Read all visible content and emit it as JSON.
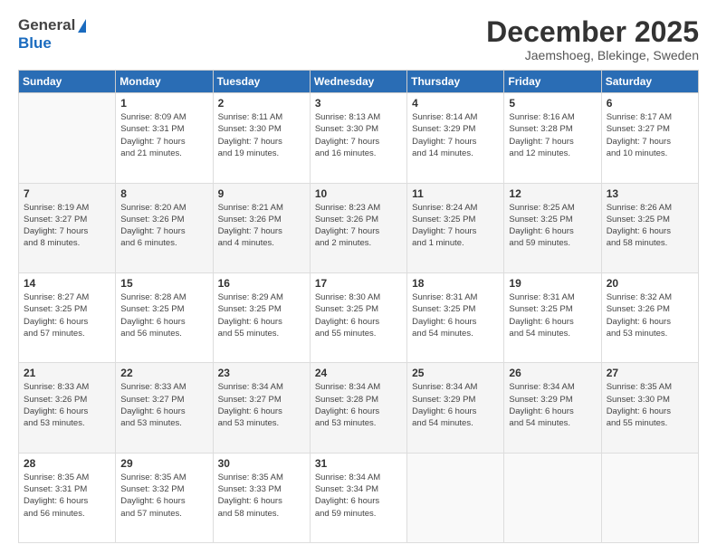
{
  "header": {
    "logo_general": "General",
    "logo_blue": "Blue",
    "title": "December 2025",
    "subtitle": "Jaemshoeg, Blekinge, Sweden"
  },
  "calendar": {
    "days_of_week": [
      "Sunday",
      "Monday",
      "Tuesday",
      "Wednesday",
      "Thursday",
      "Friday",
      "Saturday"
    ],
    "weeks": [
      [
        {
          "day": "",
          "info": ""
        },
        {
          "day": "1",
          "info": "Sunrise: 8:09 AM\nSunset: 3:31 PM\nDaylight: 7 hours\nand 21 minutes."
        },
        {
          "day": "2",
          "info": "Sunrise: 8:11 AM\nSunset: 3:30 PM\nDaylight: 7 hours\nand 19 minutes."
        },
        {
          "day": "3",
          "info": "Sunrise: 8:13 AM\nSunset: 3:30 PM\nDaylight: 7 hours\nand 16 minutes."
        },
        {
          "day": "4",
          "info": "Sunrise: 8:14 AM\nSunset: 3:29 PM\nDaylight: 7 hours\nand 14 minutes."
        },
        {
          "day": "5",
          "info": "Sunrise: 8:16 AM\nSunset: 3:28 PM\nDaylight: 7 hours\nand 12 minutes."
        },
        {
          "day": "6",
          "info": "Sunrise: 8:17 AM\nSunset: 3:27 PM\nDaylight: 7 hours\nand 10 minutes."
        }
      ],
      [
        {
          "day": "7",
          "info": "Sunrise: 8:19 AM\nSunset: 3:27 PM\nDaylight: 7 hours\nand 8 minutes."
        },
        {
          "day": "8",
          "info": "Sunrise: 8:20 AM\nSunset: 3:26 PM\nDaylight: 7 hours\nand 6 minutes."
        },
        {
          "day": "9",
          "info": "Sunrise: 8:21 AM\nSunset: 3:26 PM\nDaylight: 7 hours\nand 4 minutes."
        },
        {
          "day": "10",
          "info": "Sunrise: 8:23 AM\nSunset: 3:26 PM\nDaylight: 7 hours\nand 2 minutes."
        },
        {
          "day": "11",
          "info": "Sunrise: 8:24 AM\nSunset: 3:25 PM\nDaylight: 7 hours\nand 1 minute."
        },
        {
          "day": "12",
          "info": "Sunrise: 8:25 AM\nSunset: 3:25 PM\nDaylight: 6 hours\nand 59 minutes."
        },
        {
          "day": "13",
          "info": "Sunrise: 8:26 AM\nSunset: 3:25 PM\nDaylight: 6 hours\nand 58 minutes."
        }
      ],
      [
        {
          "day": "14",
          "info": "Sunrise: 8:27 AM\nSunset: 3:25 PM\nDaylight: 6 hours\nand 57 minutes."
        },
        {
          "day": "15",
          "info": "Sunrise: 8:28 AM\nSunset: 3:25 PM\nDaylight: 6 hours\nand 56 minutes."
        },
        {
          "day": "16",
          "info": "Sunrise: 8:29 AM\nSunset: 3:25 PM\nDaylight: 6 hours\nand 55 minutes."
        },
        {
          "day": "17",
          "info": "Sunrise: 8:30 AM\nSunset: 3:25 PM\nDaylight: 6 hours\nand 55 minutes."
        },
        {
          "day": "18",
          "info": "Sunrise: 8:31 AM\nSunset: 3:25 PM\nDaylight: 6 hours\nand 54 minutes."
        },
        {
          "day": "19",
          "info": "Sunrise: 8:31 AM\nSunset: 3:25 PM\nDaylight: 6 hours\nand 54 minutes."
        },
        {
          "day": "20",
          "info": "Sunrise: 8:32 AM\nSunset: 3:26 PM\nDaylight: 6 hours\nand 53 minutes."
        }
      ],
      [
        {
          "day": "21",
          "info": "Sunrise: 8:33 AM\nSunset: 3:26 PM\nDaylight: 6 hours\nand 53 minutes."
        },
        {
          "day": "22",
          "info": "Sunrise: 8:33 AM\nSunset: 3:27 PM\nDaylight: 6 hours\nand 53 minutes."
        },
        {
          "day": "23",
          "info": "Sunrise: 8:34 AM\nSunset: 3:27 PM\nDaylight: 6 hours\nand 53 minutes."
        },
        {
          "day": "24",
          "info": "Sunrise: 8:34 AM\nSunset: 3:28 PM\nDaylight: 6 hours\nand 53 minutes."
        },
        {
          "day": "25",
          "info": "Sunrise: 8:34 AM\nSunset: 3:29 PM\nDaylight: 6 hours\nand 54 minutes."
        },
        {
          "day": "26",
          "info": "Sunrise: 8:34 AM\nSunset: 3:29 PM\nDaylight: 6 hours\nand 54 minutes."
        },
        {
          "day": "27",
          "info": "Sunrise: 8:35 AM\nSunset: 3:30 PM\nDaylight: 6 hours\nand 55 minutes."
        }
      ],
      [
        {
          "day": "28",
          "info": "Sunrise: 8:35 AM\nSunset: 3:31 PM\nDaylight: 6 hours\nand 56 minutes."
        },
        {
          "day": "29",
          "info": "Sunrise: 8:35 AM\nSunset: 3:32 PM\nDaylight: 6 hours\nand 57 minutes."
        },
        {
          "day": "30",
          "info": "Sunrise: 8:35 AM\nSunset: 3:33 PM\nDaylight: 6 hours\nand 58 minutes."
        },
        {
          "day": "31",
          "info": "Sunrise: 8:34 AM\nSunset: 3:34 PM\nDaylight: 6 hours\nand 59 minutes."
        },
        {
          "day": "",
          "info": ""
        },
        {
          "day": "",
          "info": ""
        },
        {
          "day": "",
          "info": ""
        }
      ]
    ]
  }
}
